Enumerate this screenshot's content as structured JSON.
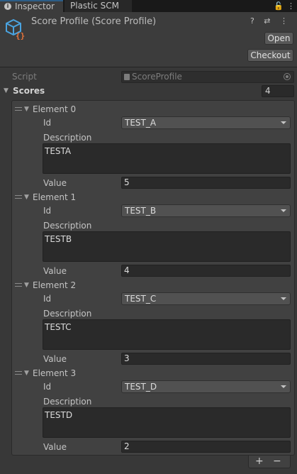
{
  "tabs": {
    "inspector_label": "Inspector",
    "plastic_label": "Plastic SCM",
    "lock_glyph": "🔓",
    "menu_glyph": "⋮"
  },
  "header": {
    "title": "Score Profile (Score Profile)",
    "icons_text": "? ⇄ ⋮",
    "open_label": "Open",
    "checkout_label": "Checkout",
    "icon_name": "scriptable-object-icon"
  },
  "script": {
    "label": "Script",
    "value": "ScoreProfile"
  },
  "scores": {
    "label": "Scores",
    "count": "4",
    "fold_glyph": "▼",
    "elements": [
      {
        "label": "Element 0",
        "id_label": "Id",
        "id_value": "TEST_A",
        "desc_label": "Description",
        "desc_value": "TESTA",
        "value_label": "Value",
        "value": "5"
      },
      {
        "label": "Element 1",
        "id_label": "Id",
        "id_value": "TEST_B",
        "desc_label": "Description",
        "desc_value": "TESTB",
        "value_label": "Value",
        "value": "4"
      },
      {
        "label": "Element 2",
        "id_label": "Id",
        "id_value": "TEST_C",
        "desc_label": "Description",
        "desc_value": "TESTC",
        "value_label": "Value",
        "value": "3"
      },
      {
        "label": "Element 3",
        "id_label": "Id",
        "id_value": "TEST_D",
        "desc_label": "Description",
        "desc_value": "TESTD",
        "value_label": "Value",
        "value": "2"
      }
    ]
  },
  "footer": {
    "add_glyph": "+",
    "remove_glyph": "−"
  },
  "colors": {
    "background": "#383838",
    "tab_accent": "#2c5d87",
    "icon_blue": "#4aa3df",
    "icon_orange": "#e8743b"
  }
}
